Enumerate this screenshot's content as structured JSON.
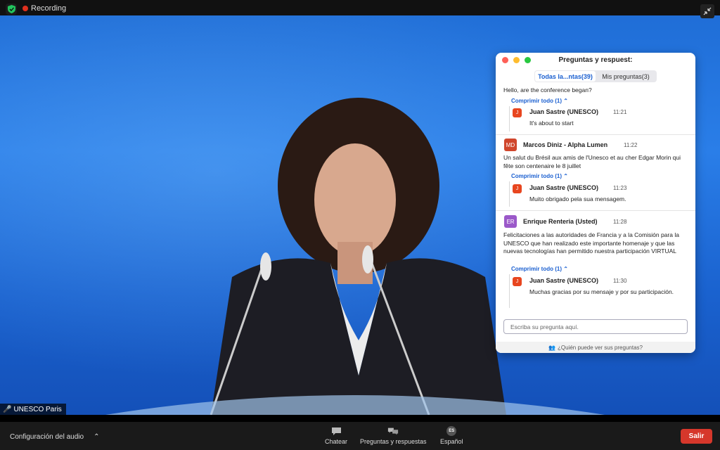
{
  "topbar": {
    "recording_label": "Recording"
  },
  "video": {
    "speaker_name": "UNESCO Paris"
  },
  "qa_panel": {
    "title": "Preguntas y respuest:",
    "tabs": [
      {
        "label": "Todas la...ntas(39)",
        "active": true
      },
      {
        "label": "Mis preguntas(3)",
        "active": false
      }
    ],
    "items": [
      {
        "question": "Hello, are the conference began?",
        "collapse_label": "Comprimir todo (1)",
        "reply": {
          "initial": "J",
          "author": "Juan Sastre (UNESCO)",
          "time": "11:21",
          "text": "It's about to start"
        }
      },
      {
        "avatar": "MD",
        "author": "Marcos Diniz - Alpha Lumen",
        "time": "11:22",
        "question": "Un salut du Brésil aux amis de l'Unesco et au cher Edgar Morin qui fête son centenaire le 8 juillet",
        "collapse_label": "Comprimir todo (1)",
        "reply": {
          "initial": "J",
          "author": "Juan Sastre (UNESCO)",
          "time": "11:23",
          "text": "Muito obrigado pela sua mensagem."
        }
      },
      {
        "avatar": "ER",
        "author": "Enrique Renteria (Usted)",
        "time": "11:28",
        "question": "Felicitaciones a las autoridades de Francia y a la Comisión para la UNESCO que han realizado este importante homenaje y que las nuevas tecnologías han permitido nuestra participación VIRTUAL",
        "collapse_label": "Comprimir todo (1)",
        "reply": {
          "initial": "J",
          "author": "Juan Sastre (UNESCO)",
          "time": "11:30",
          "text": "Muchas gracias por su mensaje y por su participación."
        }
      }
    ],
    "input_placeholder": "Escriba su pregunta aquí.",
    "footer_link": "¿Quién puede ver sus preguntas?"
  },
  "toolbar": {
    "audio_label": "Configuración del audio",
    "chat_label": "Chatear",
    "qa_label": "Preguntas y respuestas",
    "language_badge": "ES",
    "language_label": "Español",
    "exit_label": "Salir"
  },
  "colors": {
    "accent": "#1a5fd0",
    "exit": "#d6372b",
    "reply_avatar": "#e8461f",
    "md_avatar": "#d0462c",
    "er_avatar": "#9b59c9"
  }
}
